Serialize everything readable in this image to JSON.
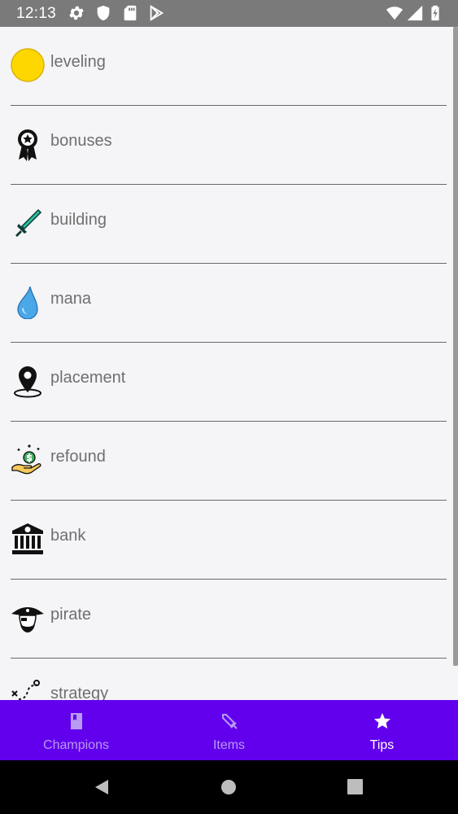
{
  "status_bar": {
    "time": "12:13",
    "left_icons": [
      "gear-icon",
      "shield-icon",
      "sd-card-icon",
      "play-store-icon"
    ],
    "right_icons": [
      "wifi-icon",
      "signal-icon",
      "battery-charging-icon"
    ]
  },
  "tips_list": [
    {
      "label": "leveling",
      "icon": "gold-coin-icon"
    },
    {
      "label": "bonuses",
      "icon": "award-ribbon-icon"
    },
    {
      "label": "building",
      "icon": "sword-icon"
    },
    {
      "label": "mana",
      "icon": "water-drop-icon"
    },
    {
      "label": "placement",
      "icon": "map-pin-icon"
    },
    {
      "label": "refound",
      "icon": "money-hand-icon"
    },
    {
      "label": "bank",
      "icon": "bank-icon"
    },
    {
      "label": "pirate",
      "icon": "pirate-icon"
    },
    {
      "label": "strategy",
      "icon": "strategy-icon"
    }
  ],
  "bottom_nav": {
    "tabs": [
      {
        "label": "Champions",
        "icon": "book-icon",
        "active": false
      },
      {
        "label": "Items",
        "icon": "sword-outline-icon",
        "active": false
      },
      {
        "label": "Tips",
        "icon": "star-icon",
        "active": true
      }
    ],
    "background": "#6200ee",
    "active_color": "#ffffff",
    "inactive_color": "#b79bf3"
  },
  "system_nav": {
    "buttons": [
      "back-icon",
      "home-icon",
      "recents-icon"
    ]
  }
}
